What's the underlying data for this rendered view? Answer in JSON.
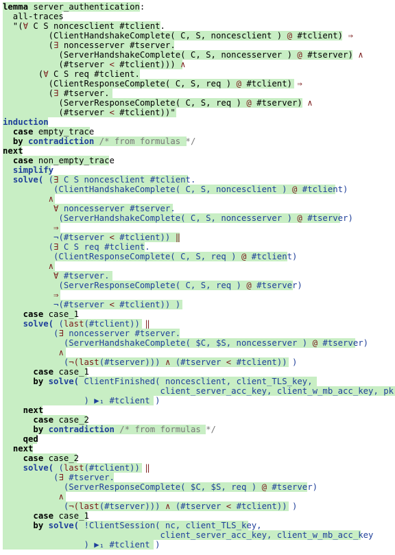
{
  "colors": {
    "text": "#000000",
    "command": "#1f3f9a",
    "operator": "#7a1a1a",
    "comment": "#777777",
    "highlight": "#c8eec4"
  },
  "lines": [
    {
      "segments": [
        {
          "t": "lemma",
          "c": "kw"
        },
        {
          "t": " server_authentication:",
          "c": "pl"
        }
      ],
      "bg": [
        [
          0,
          200
        ]
      ]
    },
    {
      "segments": [
        {
          "t": "  all-traces",
          "c": "pl"
        }
      ],
      "bg": [
        [
          0,
          86
        ]
      ]
    },
    {
      "segments": [
        {
          "t": "  \"(",
          "c": "pl"
        },
        {
          "t": "∀",
          "c": "rd"
        },
        {
          "t": " C S noncesclient #tclient.",
          "c": "pl"
        }
      ],
      "bg": [
        [
          0,
          230
        ]
      ]
    },
    {
      "segments": [
        {
          "t": "         (ClientHandshakeComplete( C, S, noncesclient ) ",
          "c": "pl"
        },
        {
          "t": "@",
          "c": "rd"
        },
        {
          "t": " #tclient) ",
          "c": "pl"
        },
        {
          "t": "⇒",
          "c": "rd"
        }
      ],
      "bg": [
        [
          0,
          495
        ]
      ]
    },
    {
      "segments": [
        {
          "t": "         (",
          "c": "pl"
        },
        {
          "t": "∃",
          "c": "rd"
        },
        {
          "t": " noncesserver #tserver.",
          "c": "pl"
        }
      ],
      "bg": [
        [
          0,
          250
        ]
      ]
    },
    {
      "segments": [
        {
          "t": "           (ServerHandshakeComplete( C, S, noncesserver ) ",
          "c": "pl"
        },
        {
          "t": "@",
          "c": "rd"
        },
        {
          "t": " #tserver) ",
          "c": "pl"
        },
        {
          "t": "∧",
          "c": "rd"
        }
      ],
      "bg": [
        [
          0,
          510
        ]
      ]
    },
    {
      "segments": [
        {
          "t": "           (#tserver ",
          "c": "pl"
        },
        {
          "t": "<",
          "c": "rd"
        },
        {
          "t": " #tclient))) ",
          "c": "pl"
        },
        {
          "t": "∧",
          "c": "rd"
        }
      ],
      "bg": [
        [
          0,
          262
        ]
      ]
    },
    {
      "segments": [
        {
          "t": "       (",
          "c": "pl"
        },
        {
          "t": "∀",
          "c": "rd"
        },
        {
          "t": " C S req #tclient.",
          "c": "pl"
        }
      ],
      "bg": [
        [
          0,
          200
        ]
      ]
    },
    {
      "segments": [
        {
          "t": "         (ClientResponseComplete( C, S, req ) ",
          "c": "pl"
        },
        {
          "t": "@",
          "c": "rd"
        },
        {
          "t": " #tclient) ",
          "c": "pl"
        },
        {
          "t": "⇒",
          "c": "rd"
        }
      ],
      "bg": [
        [
          0,
          425
        ]
      ]
    },
    {
      "segments": [
        {
          "t": "         (",
          "c": "pl"
        },
        {
          "t": "∃",
          "c": "rd"
        },
        {
          "t": " #tserver.",
          "c": "pl"
        }
      ],
      "bg": [
        [
          0,
          160
        ]
      ]
    },
    {
      "segments": [
        {
          "t": "           (ServerResponseComplete( C, S, req ) ",
          "c": "pl"
        },
        {
          "t": "@",
          "c": "rd"
        },
        {
          "t": " #tserver) ",
          "c": "pl"
        },
        {
          "t": "∧",
          "c": "rd"
        }
      ],
      "bg": [
        [
          0,
          437
        ]
      ]
    },
    {
      "segments": [
        {
          "t": "           (#tserver ",
          "c": "pl"
        },
        {
          "t": "<",
          "c": "rd"
        },
        {
          "t": " #tclient))\"",
          "c": "pl"
        }
      ],
      "bg": [
        [
          0,
          253
        ]
      ]
    },
    {
      "segments": [
        {
          "t": "induction",
          "c": "nv"
        }
      ],
      "bg": [
        [
          0,
          66
        ]
      ]
    },
    {
      "segments": [
        {
          "t": "  ",
          "c": "pl"
        },
        {
          "t": "case",
          "c": "kw"
        },
        {
          "t": " empty_trace",
          "c": "pl"
        }
      ],
      "bg": [
        [
          0,
          127
        ]
      ]
    },
    {
      "segments": [
        {
          "t": "  ",
          "c": "pl"
        },
        {
          "t": "by",
          "c": "kw"
        },
        {
          "t": " ",
          "c": "pl"
        },
        {
          "t": "contradiction",
          "c": "nv"
        },
        {
          "t": " /* from formulas */",
          "c": "cm"
        }
      ],
      "bg": [
        [
          0,
          268
        ]
      ]
    },
    {
      "segments": [
        {
          "t": "next",
          "c": "kw"
        }
      ],
      "bg": [
        [
          0,
          28
        ]
      ]
    },
    {
      "segments": [
        {
          "t": "  ",
          "c": "pl"
        },
        {
          "t": "case",
          "c": "kw"
        },
        {
          "t": " non_empty_trace",
          "c": "pl"
        }
      ],
      "bg": [
        [
          0,
          155
        ]
      ]
    },
    {
      "segments": [
        {
          "t": "  ",
          "c": "pl"
        },
        {
          "t": "simplify",
          "c": "nv"
        }
      ],
      "bg": [
        [
          0,
          70
        ]
      ]
    },
    {
      "segments": [
        {
          "t": "  ",
          "c": "pl"
        },
        {
          "t": "solve(",
          "c": "nv"
        },
        {
          "t": " (",
          "c": "bl"
        },
        {
          "t": "∃",
          "c": "rd"
        },
        {
          "t": " C S noncesclient #tclient.",
          "c": "bl"
        }
      ],
      "bg": [
        [
          0,
          270
        ]
      ]
    },
    {
      "segments": [
        {
          "t": "          (ClientHandshakeComplete( C, S, noncesclient ) ",
          "c": "bl"
        },
        {
          "t": "@",
          "c": "rd"
        },
        {
          "t": " #tclient)",
          "c": "bl"
        }
      ],
      "bg": [
        [
          0,
          485
        ]
      ]
    },
    {
      "segments": [
        {
          "t": "         ",
          "c": "pl"
        },
        {
          "t": "∧",
          "c": "rd"
        }
      ],
      "bg": [
        [
          0,
          76
        ]
      ]
    },
    {
      "segments": [
        {
          "t": "          ",
          "c": "pl"
        },
        {
          "t": "∀",
          "c": "rd"
        },
        {
          "t": " noncesserver #tserver.",
          "c": "bl"
        }
      ],
      "bg": [
        [
          0,
          248
        ]
      ]
    },
    {
      "segments": [
        {
          "t": "           (ServerHandshakeComplete( C, S, noncesserver ) ",
          "c": "bl"
        },
        {
          "t": "@",
          "c": "rd"
        },
        {
          "t": " #tserver)",
          "c": "bl"
        }
      ],
      "bg": [
        [
          0,
          492
        ]
      ]
    },
    {
      "segments": [
        {
          "t": "          ",
          "c": "pl"
        },
        {
          "t": "⇒",
          "c": "rd"
        }
      ],
      "bg": [
        [
          0,
          84
        ]
      ]
    },
    {
      "segments": [
        {
          "t": "          ",
          "c": "pl"
        },
        {
          "t": "¬(#tserver ",
          "c": "bl"
        },
        {
          "t": "<",
          "c": "rd"
        },
        {
          "t": " #tclient)) ",
          "c": "bl"
        },
        {
          "t": "‖",
          "c": "rd"
        }
      ],
      "bg": [
        [
          0,
          258
        ]
      ]
    },
    {
      "segments": [
        {
          "t": "         (",
          "c": "bl"
        },
        {
          "t": "∃",
          "c": "rd"
        },
        {
          "t": " C S req #tclient.",
          "c": "bl"
        }
      ],
      "bg": [
        [
          0,
          207
        ]
      ]
    },
    {
      "segments": [
        {
          "t": "          (ClientResponseComplete( C, S, req ) ",
          "c": "bl"
        },
        {
          "t": "@",
          "c": "rd"
        },
        {
          "t": " #tclient)",
          "c": "bl"
        }
      ],
      "bg": [
        [
          0,
          415
        ]
      ]
    },
    {
      "segments": [
        {
          "t": "         ",
          "c": "pl"
        },
        {
          "t": "∧",
          "c": "rd"
        }
      ],
      "bg": [
        [
          0,
          76
        ]
      ]
    },
    {
      "segments": [
        {
          "t": "          ",
          "c": "pl"
        },
        {
          "t": "∀",
          "c": "rd"
        },
        {
          "t": " #tserver.",
          "c": "bl"
        }
      ],
      "bg": [
        [
          0,
          160
        ]
      ]
    },
    {
      "segments": [
        {
          "t": "           (ServerResponseComplete( C, S, req ) ",
          "c": "bl"
        },
        {
          "t": "@",
          "c": "rd"
        },
        {
          "t": " #tserver)",
          "c": "bl"
        }
      ],
      "bg": [
        [
          0,
          423
        ]
      ]
    },
    {
      "segments": [
        {
          "t": "          ",
          "c": "pl"
        },
        {
          "t": "⇒",
          "c": "rd"
        }
      ],
      "bg": [
        [
          0,
          84
        ]
      ]
    },
    {
      "segments": [
        {
          "t": "          ",
          "c": "pl"
        },
        {
          "t": "¬(#tserver ",
          "c": "bl"
        },
        {
          "t": "<",
          "c": "rd"
        },
        {
          "t": " #tclient)) )",
          "c": "bl"
        }
      ],
      "bg": [
        [
          0,
          262
        ]
      ]
    },
    {
      "segments": [
        {
          "t": "    ",
          "c": "pl"
        },
        {
          "t": "case",
          "c": "kw"
        },
        {
          "t": " case_1",
          "c": "pl"
        }
      ],
      "bg": [
        [
          0,
          108
        ]
      ]
    },
    {
      "segments": [
        {
          "t": "    ",
          "c": "pl"
        },
        {
          "t": "solve(",
          "c": "nv"
        },
        {
          "t": " (",
          "c": "bl"
        },
        {
          "t": "last",
          "c": "rd"
        },
        {
          "t": "(#tclient)) ",
          "c": "bl"
        },
        {
          "t": "‖",
          "c": "rd"
        }
      ],
      "bg": [
        [
          0,
          203
        ]
      ]
    },
    {
      "segments": [
        {
          "t": "          (",
          "c": "bl"
        },
        {
          "t": "∃",
          "c": "rd"
        },
        {
          "t": " noncesserver #tserver.",
          "c": "bl"
        }
      ],
      "bg": [
        [
          0,
          258
        ]
      ]
    },
    {
      "segments": [
        {
          "t": "            (ServerHandshakeComplete( $C, $S, noncesserver ) ",
          "c": "bl"
        },
        {
          "t": "@",
          "c": "rd"
        },
        {
          "t": " #tserver)",
          "c": "bl"
        }
      ],
      "bg": [
        [
          0,
          514
        ]
      ]
    },
    {
      "segments": [
        {
          "t": "           ",
          "c": "pl"
        },
        {
          "t": "∧",
          "c": "rd"
        }
      ],
      "bg": [
        [
          0,
          92
        ]
      ]
    },
    {
      "segments": [
        {
          "t": "            (",
          "c": "bl"
        },
        {
          "t": "¬(",
          "c": "rd"
        },
        {
          "t": "last",
          "c": "rd"
        },
        {
          "t": "(#tserver))) ",
          "c": "bl"
        },
        {
          "t": "∧",
          "c": "rd"
        },
        {
          "t": " (#tserver ",
          "c": "bl"
        },
        {
          "t": "<",
          "c": "rd"
        },
        {
          "t": " #tclient)) )",
          "c": "bl"
        }
      ],
      "bg": [
        [
          0,
          417
        ]
      ]
    },
    {
      "segments": [
        {
          "t": "      ",
          "c": "pl"
        },
        {
          "t": "case",
          "c": "kw"
        },
        {
          "t": " case_1",
          "c": "pl"
        }
      ],
      "bg": [
        [
          0,
          123
        ]
      ]
    },
    {
      "segments": [
        {
          "t": "      ",
          "c": "pl"
        },
        {
          "t": "by",
          "c": "kw"
        },
        {
          "t": " ",
          "c": "pl"
        },
        {
          "t": "solve(",
          "c": "nv"
        },
        {
          "t": " ClientFinished( noncesclient, client_TLS_key,",
          "c": "bl"
        }
      ],
      "bg": [
        [
          0,
          458
        ]
      ]
    },
    {
      "segments": [
        {
          "t": "                               client_server_acc_key, client_w_mb_acc_key, pk(t)",
          "c": "bl"
        }
      ],
      "bg": [
        [
          0,
          572
        ]
      ]
    },
    {
      "segments": [
        {
          "t": "                ) ",
          "c": "bl"
        },
        {
          "t": "▶₁",
          "c": "bl"
        },
        {
          "t": " #tclient )",
          "c": "bl"
        }
      ],
      "bg": [
        [
          0,
          220
        ]
      ]
    },
    {
      "segments": [
        {
          "t": "    ",
          "c": "pl"
        },
        {
          "t": "next",
          "c": "kw"
        }
      ],
      "bg": [
        [
          0,
          58
        ]
      ]
    },
    {
      "segments": [
        {
          "t": "      ",
          "c": "pl"
        },
        {
          "t": "case",
          "c": "kw"
        },
        {
          "t": " case_2",
          "c": "pl"
        }
      ],
      "bg": [
        [
          0,
          123
        ]
      ]
    },
    {
      "segments": [
        {
          "t": "      ",
          "c": "pl"
        },
        {
          "t": "by",
          "c": "kw"
        },
        {
          "t": " ",
          "c": "pl"
        },
        {
          "t": "contradiction",
          "c": "nv"
        },
        {
          "t": " /* from formulas */",
          "c": "cm"
        }
      ],
      "bg": [
        [
          0,
          296
        ]
      ]
    },
    {
      "segments": [
        {
          "t": "    ",
          "c": "pl"
        },
        {
          "t": "qed",
          "c": "kw"
        }
      ],
      "bg": [
        [
          0,
          50
        ]
      ]
    },
    {
      "segments": [
        {
          "t": "  ",
          "c": "pl"
        },
        {
          "t": "next",
          "c": "kw"
        }
      ],
      "bg": [
        [
          0,
          44
        ]
      ]
    },
    {
      "segments": [
        {
          "t": "    ",
          "c": "pl"
        },
        {
          "t": "case",
          "c": "kw"
        },
        {
          "t": " case_2",
          "c": "pl"
        }
      ],
      "bg": [
        [
          0,
          108
        ]
      ]
    },
    {
      "segments": [
        {
          "t": "    ",
          "c": "pl"
        },
        {
          "t": "solve(",
          "c": "nv"
        },
        {
          "t": " (",
          "c": "bl"
        },
        {
          "t": "last",
          "c": "rd"
        },
        {
          "t": "(#tclient)) ",
          "c": "bl"
        },
        {
          "t": "‖",
          "c": "rd"
        }
      ],
      "bg": [
        [
          0,
          203
        ]
      ]
    },
    {
      "segments": [
        {
          "t": "          (",
          "c": "bl"
        },
        {
          "t": "∃",
          "c": "rd"
        },
        {
          "t": " #tserver.",
          "c": "bl"
        }
      ],
      "bg": [
        [
          0,
          162
        ]
      ]
    },
    {
      "segments": [
        {
          "t": "            (ServerResponseComplete( $C, $S, req ) ",
          "c": "bl"
        },
        {
          "t": "@",
          "c": "rd"
        },
        {
          "t": " #tserver)",
          "c": "bl"
        }
      ],
      "bg": [
        [
          0,
          444
        ]
      ]
    },
    {
      "segments": [
        {
          "t": "           ",
          "c": "pl"
        },
        {
          "t": "∧",
          "c": "rd"
        }
      ],
      "bg": [
        [
          0,
          92
        ]
      ]
    },
    {
      "segments": [
        {
          "t": "            (",
          "c": "bl"
        },
        {
          "t": "¬(",
          "c": "rd"
        },
        {
          "t": "last",
          "c": "rd"
        },
        {
          "t": "(#tserver))) ",
          "c": "bl"
        },
        {
          "t": "∧",
          "c": "rd"
        },
        {
          "t": " (#tserver ",
          "c": "bl"
        },
        {
          "t": "<",
          "c": "rd"
        },
        {
          "t": " #tclient)) )",
          "c": "bl"
        }
      ],
      "bg": [
        [
          0,
          417
        ]
      ]
    },
    {
      "segments": [
        {
          "t": "      ",
          "c": "pl"
        },
        {
          "t": "case",
          "c": "kw"
        },
        {
          "t": " case_1",
          "c": "pl"
        }
      ],
      "bg": [
        [
          0,
          123
        ]
      ]
    },
    {
      "segments": [
        {
          "t": "      ",
          "c": "pl"
        },
        {
          "t": "by",
          "c": "kw"
        },
        {
          "t": " ",
          "c": "pl"
        },
        {
          "t": "solve(",
          "c": "nv"
        },
        {
          "t": " !ClientSession( nc, client_TLS_key,",
          "c": "bl"
        }
      ],
      "bg": [
        [
          0,
          358
        ]
      ]
    },
    {
      "segments": [
        {
          "t": "                               client_server_acc_key, client_w_mb_acc_key",
          "c": "bl"
        }
      ],
      "bg": [
        [
          0,
          522
        ]
      ]
    },
    {
      "segments": [
        {
          "t": "                ) ",
          "c": "bl"
        },
        {
          "t": "▶₁",
          "c": "bl"
        },
        {
          "t": " #tclient )",
          "c": "bl"
        }
      ],
      "bg": [
        [
          0,
          220
        ]
      ]
    }
  ]
}
